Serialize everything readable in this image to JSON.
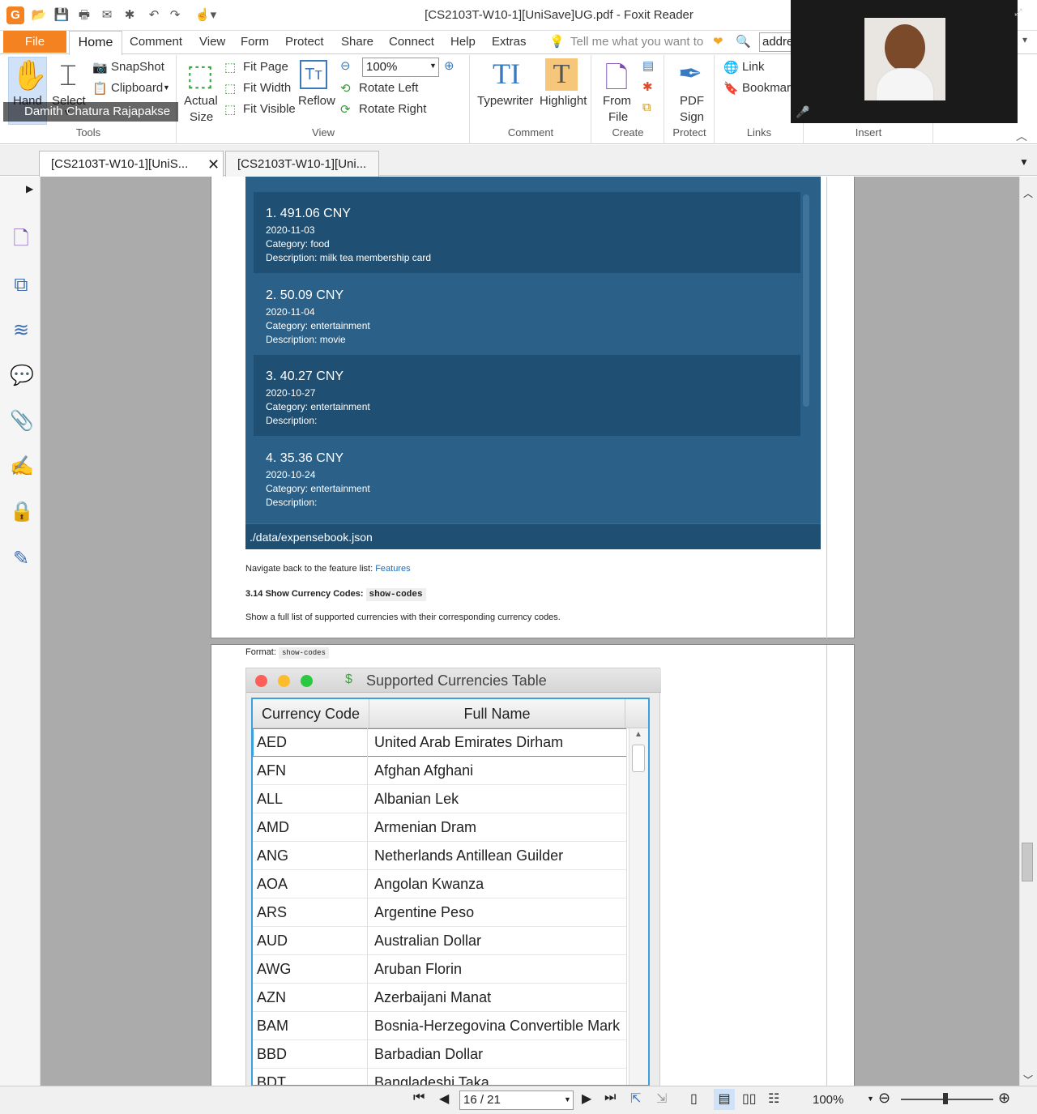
{
  "window": {
    "title": "[CS2103T-W10-1][UniSave]UG.pdf - Foxit Reader"
  },
  "menu": {
    "file": "File",
    "items": [
      "Home",
      "Comment",
      "View",
      "Form",
      "Protect",
      "Share",
      "Connect",
      "Help",
      "Extras"
    ],
    "tell_me": "Tell me what you want to",
    "search_value": "addre"
  },
  "ribbon": {
    "tools": {
      "hand": "Hand",
      "select": "Select",
      "snapshot": "SnapShot",
      "clipboard": "Clipboard",
      "label": "Tools"
    },
    "view": {
      "actual_size_1": "Actual",
      "actual_size_2": "Size",
      "fit_page": "Fit Page",
      "fit_width": "Fit Width",
      "fit_visible": "Fit Visible",
      "reflow": "Reflow",
      "zoom": "100%",
      "rotate_left": "Rotate Left",
      "rotate_right": "Rotate Right",
      "label": "View"
    },
    "comment": {
      "typewriter": "Typewriter",
      "highlight": "Highlight",
      "label": "Comment"
    },
    "create": {
      "from_file_1": "From",
      "from_file_2": "File",
      "label": "Create"
    },
    "protect": {
      "pdf_sign_1": "PDF",
      "pdf_sign_2": "Sign",
      "label": "Protect"
    },
    "links": {
      "link": "Link",
      "bookmark": "Bookmark",
      "label": "Links"
    },
    "insert": {
      "label": "Insert"
    }
  },
  "tabs": [
    "[CS2103T-W10-1][UniS...",
    "[CS2103T-W10-1][Uni..."
  ],
  "zoom_call": {
    "participant": "Damith Chatura Rajapakse"
  },
  "expenses": [
    {
      "title": "1.  491.06 CNY",
      "date": "2020-11-03",
      "category": "Category: food",
      "description": "Description: milk tea membership card"
    },
    {
      "title": "2.  50.09 CNY",
      "date": "2020-11-04",
      "category": "Category: entertainment",
      "description": "Description: movie"
    },
    {
      "title": "3.  40.27 CNY",
      "date": "2020-10-27",
      "category": "Category: entertainment",
      "description": "Description:"
    },
    {
      "title": "4.  35.36 CNY",
      "date": "2020-10-24",
      "category": "Category: entertainment",
      "description": "Description:"
    }
  ],
  "expense_footer": "./data/expensebook.json",
  "doc": {
    "navigate_text": "Navigate back to the feature list: ",
    "navigate_link": "Features",
    "section_heading": "3.14 Show Currency Codes: ",
    "section_code": "show-codes",
    "section_desc": "Show a full list of supported currencies with their corresponding currency codes.",
    "format_label": "Format: ",
    "format_code": "show-codes"
  },
  "currency_window": {
    "title": "Supported Currencies Table",
    "col1": "Currency Code",
    "col2": "Full Name",
    "rows": [
      [
        "AED",
        "United Arab Emirates Dirham"
      ],
      [
        "AFN",
        "Afghan Afghani"
      ],
      [
        "ALL",
        "Albanian Lek"
      ],
      [
        "AMD",
        "Armenian Dram"
      ],
      [
        "ANG",
        "Netherlands Antillean Guilder"
      ],
      [
        "AOA",
        "Angolan Kwanza"
      ],
      [
        "ARS",
        "Argentine Peso"
      ],
      [
        "AUD",
        "Australian Dollar"
      ],
      [
        "AWG",
        "Aruban Florin"
      ],
      [
        "AZN",
        "Azerbaijani Manat"
      ],
      [
        "BAM",
        "Bosnia-Herzegovina Convertible Mark"
      ],
      [
        "BBD",
        "Barbadian Dollar"
      ],
      [
        "BDT",
        "Bangladeshi Taka"
      ]
    ]
  },
  "status": {
    "page": "16 / 21",
    "zoom": "100%"
  }
}
